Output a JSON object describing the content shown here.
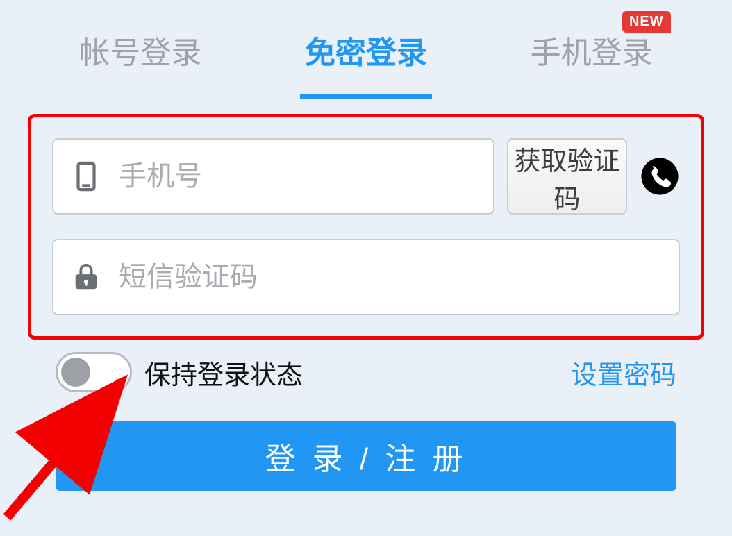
{
  "tabs": {
    "account": "帐号登录",
    "passwordless": "免密登录",
    "mobile": "手机登录",
    "new_badge": "NEW"
  },
  "form": {
    "phone_placeholder": "手机号",
    "get_code_label": "获取验证码",
    "sms_placeholder": "短信验证码"
  },
  "options": {
    "keep_login_label": "保持登录状态",
    "set_password_label": "设置密码"
  },
  "submit_label": "登 录 / 注 册"
}
